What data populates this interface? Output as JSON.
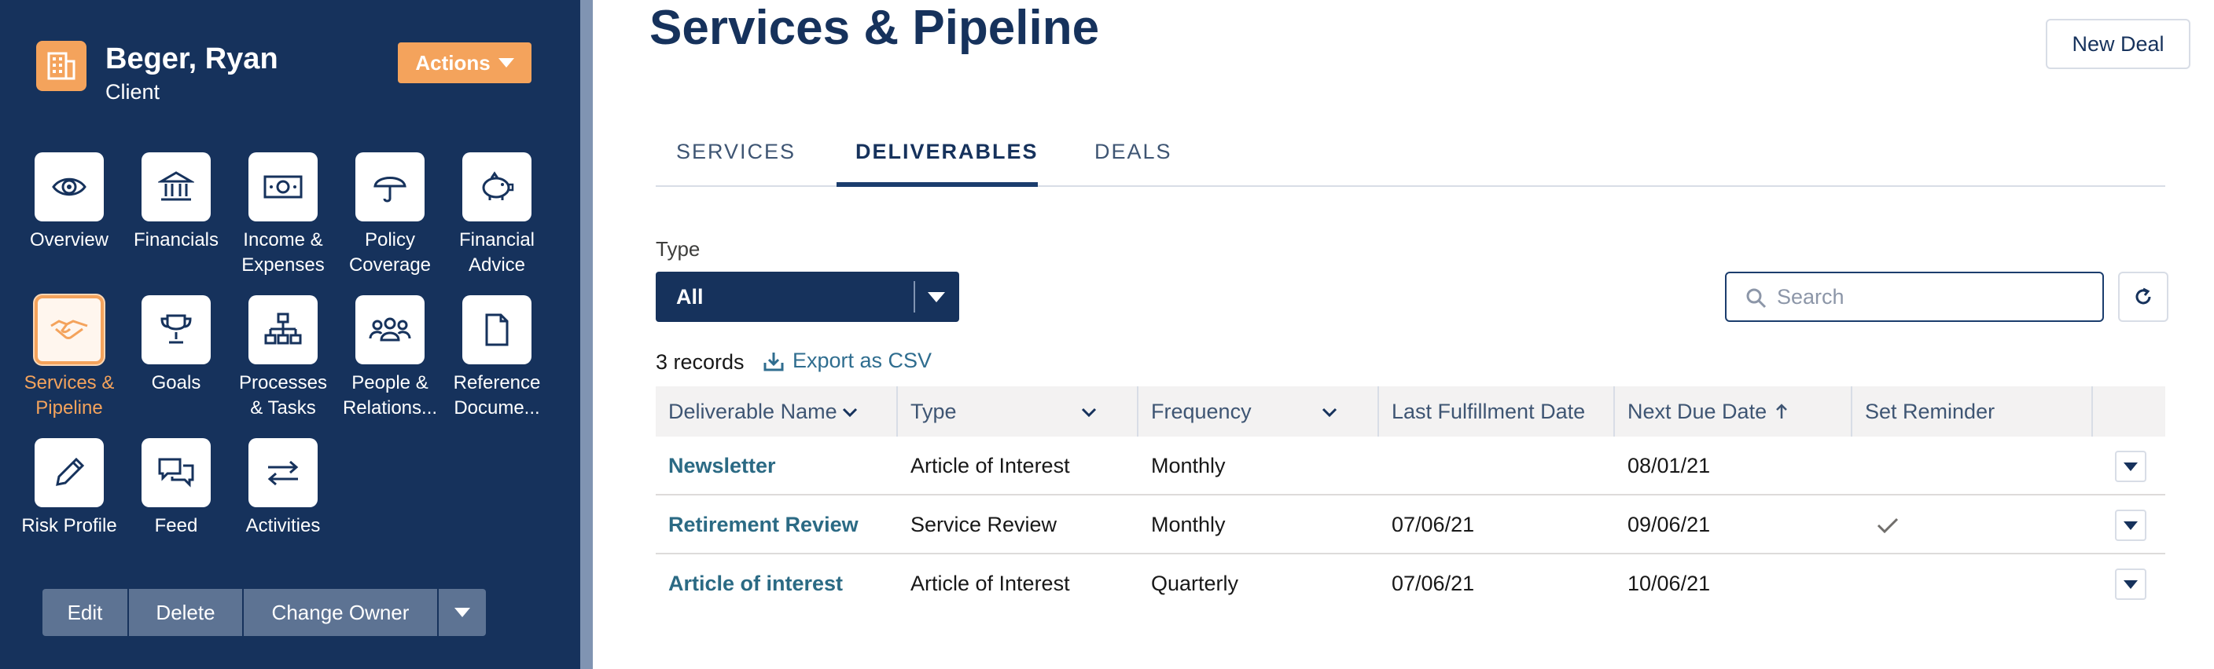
{
  "sidebar": {
    "client_name": "Beger, Ryan",
    "client_role": "Client",
    "actions_label": "Actions",
    "tiles": [
      {
        "label": "Overview",
        "icon": "eye-icon"
      },
      {
        "label": "Financials",
        "icon": "bank-icon"
      },
      {
        "label": "Income &\nExpenses",
        "icon": "money-icon"
      },
      {
        "label": "Policy\nCoverage",
        "icon": "umbrella-icon"
      },
      {
        "label": "Financial\nAdvice",
        "icon": "piggy-bank-icon"
      },
      {
        "label": "Services &\nPipeline",
        "icon": "handshake-icon",
        "active": true
      },
      {
        "label": "Goals",
        "icon": "trophy-icon"
      },
      {
        "label": "Processes\n& Tasks",
        "icon": "org-chart-icon"
      },
      {
        "label": "People &\nRelations...",
        "icon": "people-icon"
      },
      {
        "label": "Reference\nDocume...",
        "icon": "document-icon"
      },
      {
        "label": "Risk Profile",
        "icon": "pencil-icon"
      },
      {
        "label": "Feed",
        "icon": "chat-icon"
      },
      {
        "label": "Activities",
        "icon": "swap-arrows-icon"
      }
    ],
    "buttons": {
      "edit": "Edit",
      "delete": "Delete",
      "change_owner": "Change Owner"
    }
  },
  "main": {
    "title": "Services & Pipeline",
    "new_deal_label": "New Deal",
    "tabs": [
      {
        "label": "SERVICES"
      },
      {
        "label": "DELIVERABLES",
        "active": true
      },
      {
        "label": "DEALS"
      }
    ],
    "type_filter": {
      "label": "Type",
      "value": "All"
    },
    "search": {
      "placeholder": "Search",
      "value": ""
    },
    "records_count": "3 records",
    "export_label": "Export as CSV",
    "table": {
      "columns": [
        "Deliverable Name",
        "Type",
        "Frequency",
        "Last Fulfillment Date",
        "Next Due Date",
        "Set Reminder"
      ],
      "rows": [
        {
          "name": "Newsletter",
          "type": "Article of Interest",
          "frequency": "Monthly",
          "last_fulfillment": "",
          "next_due": "08/01/21",
          "reminder": false
        },
        {
          "name": "Retirement Review",
          "type": "Service Review",
          "frequency": "Monthly",
          "last_fulfillment": "07/06/21",
          "next_due": "09/06/21",
          "reminder": true
        },
        {
          "name": "Article of interest",
          "type": "Article of Interest",
          "frequency": "Quarterly",
          "last_fulfillment": "07/06/21",
          "next_due": "10/06/21",
          "reminder": false
        }
      ]
    }
  },
  "colors": {
    "sidebar_bg": "#16325c",
    "accent_orange": "#f4a35c",
    "link_teal": "#2b6a84"
  }
}
